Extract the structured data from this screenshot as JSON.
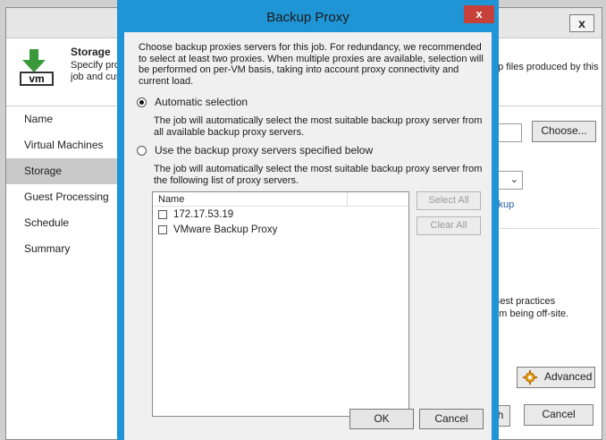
{
  "background": {
    "close_glyph": "x",
    "header": {
      "title": "Storage",
      "description_line1": "Specify pro",
      "description_line2": "job and cus",
      "description_right": "up files produced by this",
      "icon": "storage-vm-icon",
      "icon_text": "vm"
    },
    "nav": [
      "Name",
      "Virtual Machines",
      "Storage",
      "Guest Processing",
      "Schedule",
      "Summary"
    ],
    "nav_active": "Storage",
    "choose_button": "Choose...",
    "link_text": "ckup",
    "best_practices_line1": "Best practices",
    "best_practices_line2": "em being off-site.",
    "advanced_button": "Advanced",
    "partial_button": "h",
    "cancel_button": "Cancel"
  },
  "dialog": {
    "title": "Backup Proxy",
    "close_glyph": "x",
    "intro": "Choose backup proxies servers for this job. For redundancy, we recommended to select at least two proxies. When multiple proxies are available, selection will be performed on per-VM basis, taking into account proxy connectivity and current load.",
    "option_auto": {
      "label": "Automatic selection",
      "checked": true,
      "description": "The job will automatically select the most suitable backup proxy server from all available backup proxy servers."
    },
    "option_manual": {
      "label": "Use the backup proxy servers specified below",
      "checked": false,
      "description": "The job will automatically select the most suitable backup proxy server from the following list of proxy servers."
    },
    "list": {
      "column_name": "Name",
      "items": [
        {
          "name": "172.17.53.19",
          "checked": false
        },
        {
          "name": "VMware Backup Proxy",
          "checked": false
        }
      ]
    },
    "select_all_button": "Select All",
    "clear_all_button": "Clear All",
    "ok_button": "OK",
    "cancel_button": "Cancel"
  },
  "colors": {
    "dialog_frame": "#1f95d6",
    "close_button": "#c7413a",
    "nav_active": "#c9c9c9"
  }
}
